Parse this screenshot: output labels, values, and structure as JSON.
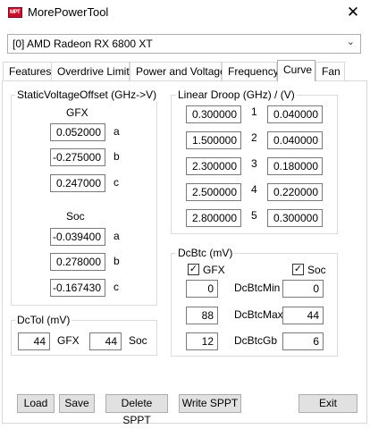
{
  "window": {
    "title": "MorePowerTool",
    "icon": "mpt-logo",
    "icon_text": "MPT"
  },
  "gpu_select": {
    "value": "[0] AMD Radeon RX 6800 XT"
  },
  "tabs": [
    {
      "label": "Features"
    },
    {
      "label": "Overdrive Limits"
    },
    {
      "label": "Power and Voltage"
    },
    {
      "label": "Frequency"
    },
    {
      "label": "Curve",
      "active": true
    },
    {
      "label": "Fan"
    }
  ],
  "static_voltage_offset": {
    "title": "StaticVoltageOffset (GHz->V)",
    "gfx_label": "GFX",
    "gfx": [
      {
        "value": "0.052000",
        "label": "a"
      },
      {
        "value": "-0.275000",
        "label": "b"
      },
      {
        "value": "0.247000",
        "label": "c"
      }
    ],
    "soc_label": "Soc",
    "soc": [
      {
        "value": "-0.039400",
        "label": "a"
      },
      {
        "value": "0.278000",
        "label": "b"
      },
      {
        "value": "-0.167430",
        "label": "c"
      }
    ]
  },
  "linear_droop": {
    "title": "Linear Droop (GHz) / (V)",
    "rows": [
      {
        "ghz": "0.300000",
        "index": "1",
        "v": "0.040000"
      },
      {
        "ghz": "1.500000",
        "index": "2",
        "v": "0.040000"
      },
      {
        "ghz": "2.300000",
        "index": "3",
        "v": "0.180000"
      },
      {
        "ghz": "2.500000",
        "index": "4",
        "v": "0.220000"
      },
      {
        "ghz": "2.800000",
        "index": "5",
        "v": "0.300000"
      }
    ]
  },
  "dctol": {
    "title": "DcTol (mV)",
    "gfx_value": "44",
    "gfx_label": "GFX",
    "soc_value": "44",
    "soc_label": "Soc"
  },
  "dcbtc": {
    "title": "DcBtc (mV)",
    "gfx_check_label": "GFX",
    "gfx_checked": true,
    "soc_check_label": "Soc",
    "soc_checked": true,
    "check_mark": "✓",
    "rows": [
      {
        "label": "DcBtcMin",
        "gfx": "0",
        "soc": "0"
      },
      {
        "label": "DcBtcMax",
        "gfx": "88",
        "soc": "44"
      },
      {
        "label": "DcBtcGb",
        "gfx": "12",
        "soc": "6"
      }
    ]
  },
  "buttons": {
    "load": "Load",
    "save": "Save",
    "delete_sppt": "Delete SPPT",
    "write_sppt": "Write SPPT",
    "exit": "Exit"
  },
  "colors": {
    "icon_red": "#c8102e",
    "button_face": "#e1e1e1",
    "border": "#adadad"
  }
}
